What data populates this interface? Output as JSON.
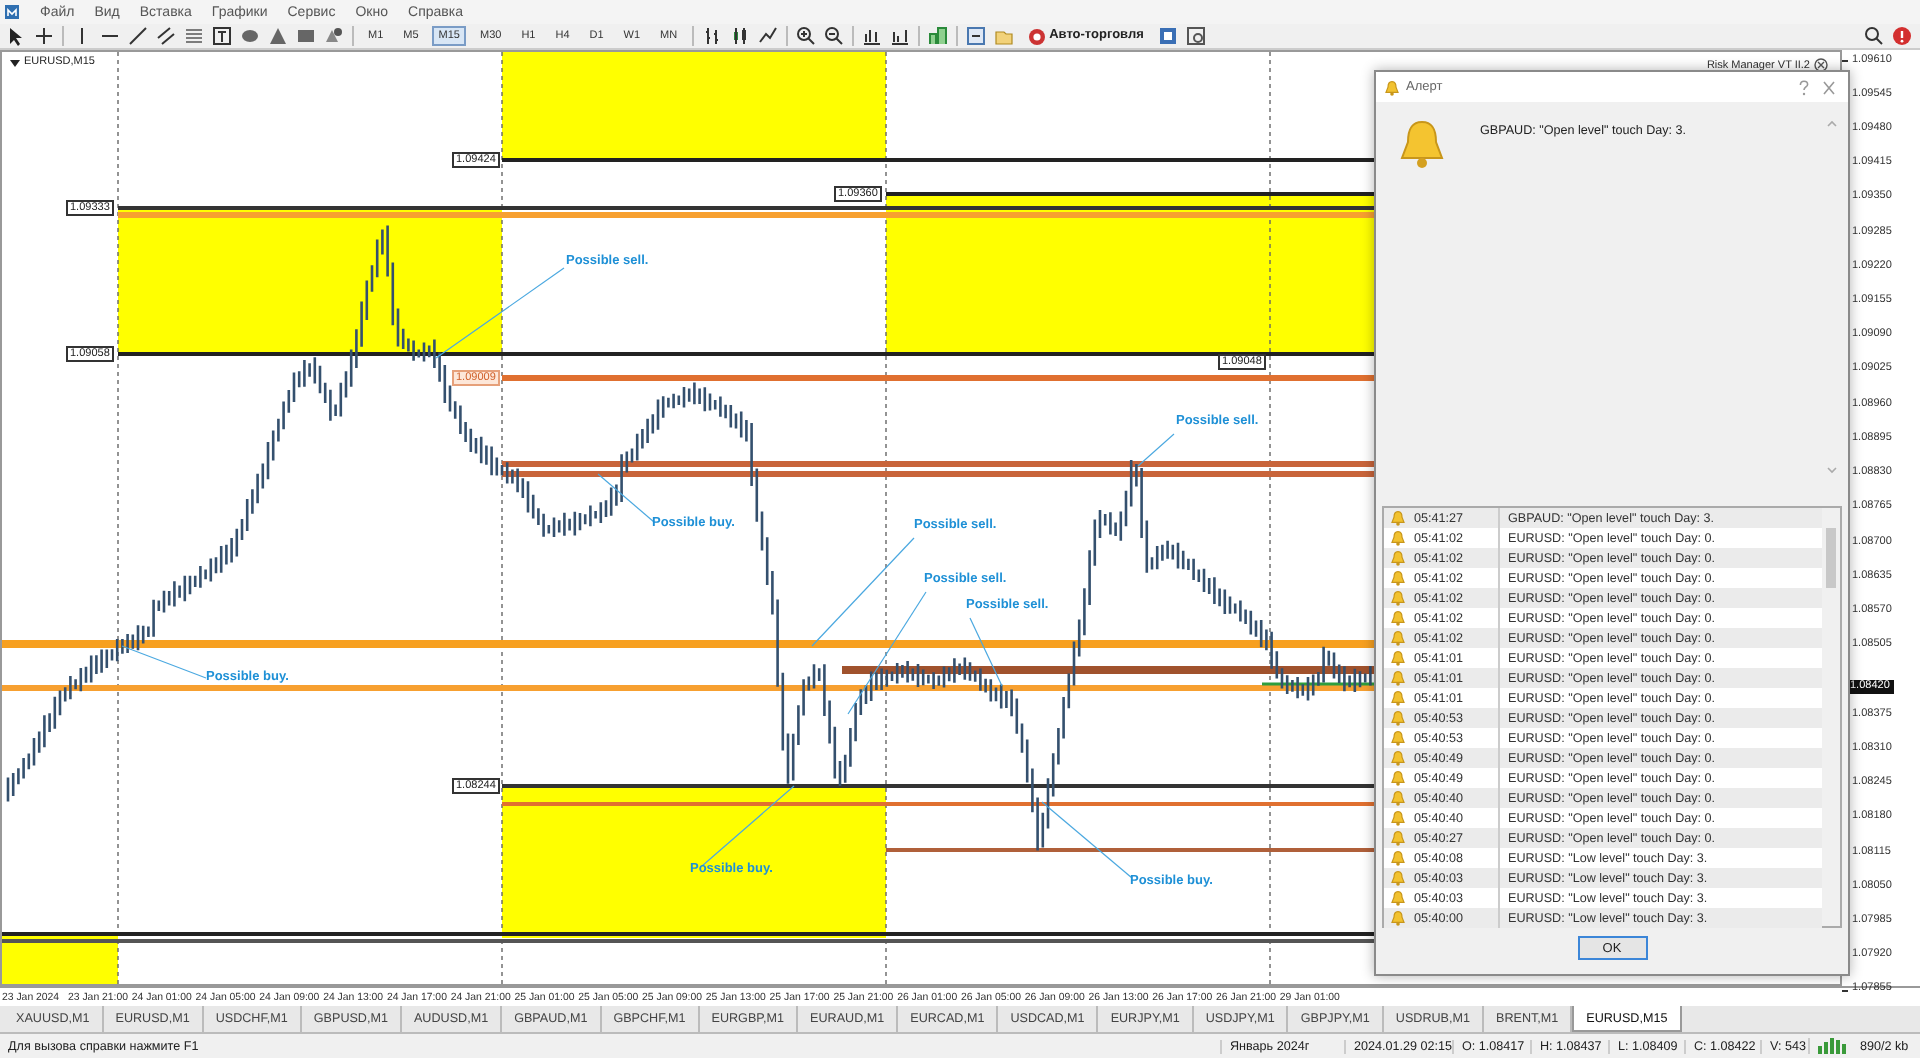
{
  "menu": [
    "Файл",
    "Вид",
    "Вставка",
    "Графики",
    "Сервис",
    "Окно",
    "Справка"
  ],
  "toolbar": {
    "timeframes": [
      {
        "label": "M1",
        "selected": false
      },
      {
        "label": "M5",
        "selected": false
      },
      {
        "label": "M15",
        "selected": true
      },
      {
        "label": "M30",
        "selected": false
      },
      {
        "label": "H1",
        "selected": false
      },
      {
        "label": "H4",
        "selected": false
      },
      {
        "label": "D1",
        "selected": false
      },
      {
        "label": "W1",
        "selected": false
      },
      {
        "label": "MN",
        "selected": false
      }
    ],
    "autotrading": "Авто-торговля"
  },
  "chart": {
    "title": "EURUSD,M15",
    "overlay_label": "Risk Manager VT II.2",
    "level_labels": [
      {
        "text": "1.09424",
        "kind": "black"
      },
      {
        "text": "1.09360",
        "kind": "black"
      },
      {
        "text": "1.09333",
        "kind": "black"
      },
      {
        "text": "1.09058",
        "kind": "black"
      },
      {
        "text": "1.09009",
        "kind": "orange"
      },
      {
        "text": "1.09048",
        "kind": "black"
      },
      {
        "text": "1.08244",
        "kind": "black"
      }
    ],
    "annotations": [
      "Possible sell.",
      "Possible sell.",
      "Possible sell.",
      "Possible sell.",
      "Possible sell.",
      "Possible buy.",
      "Possible buy.",
      "Possible buy.",
      "Possible buy."
    ],
    "price_axis": [
      "1.09610",
      "1.09545",
      "1.09480",
      "1.09415",
      "1.09350",
      "1.09285",
      "1.09220",
      "1.09155",
      "1.09090",
      "1.09025",
      "1.08960",
      "1.08895",
      "1.08830",
      "1.08765",
      "1.08700",
      "1.08635",
      "1.08570",
      "1.08505",
      "1.08375",
      "1.08310",
      "1.08245",
      "1.08180",
      "1.08115",
      "1.08050",
      "1.07985",
      "1.07920",
      "1.07855"
    ],
    "current_price": "1.08420",
    "time_axis": [
      "23 Jan 2024",
      "23 Jan 21:00",
      "24 Jan 01:00",
      "24 Jan 05:00",
      "24 Jan 09:00",
      "24 Jan 13:00",
      "24 Jan 17:00",
      "24 Jan 21:00",
      "25 Jan 01:00",
      "25 Jan 05:00",
      "25 Jan 09:00",
      "25 Jan 13:00",
      "25 Jan 17:00",
      "25 Jan 21:00",
      "26 Jan 01:00",
      "26 Jan 05:00",
      "26 Jan 09:00",
      "26 Jan 13:00",
      "26 Jan 17:00",
      "26 Jan 21:00",
      "29 Jan 01:00"
    ]
  },
  "alert": {
    "title": "Алерт",
    "message": "GBPAUD: \"Open level\" touch Day: 3.",
    "button": "OK",
    "rows": [
      {
        "time": "05:41:27",
        "text": "GBPAUD: \"Open level\" touch Day: 3."
      },
      {
        "time": "05:41:02",
        "text": "EURUSD: \"Open level\" touch Day: 0."
      },
      {
        "time": "05:41:02",
        "text": "EURUSD: \"Open level\" touch Day: 0."
      },
      {
        "time": "05:41:02",
        "text": "EURUSD: \"Open level\" touch Day: 0."
      },
      {
        "time": "05:41:02",
        "text": "EURUSD: \"Open level\" touch Day: 0."
      },
      {
        "time": "05:41:02",
        "text": "EURUSD: \"Open level\" touch Day: 0."
      },
      {
        "time": "05:41:02",
        "text": "EURUSD: \"Open level\" touch Day: 0."
      },
      {
        "time": "05:41:01",
        "text": "EURUSD: \"Open level\" touch Day: 0."
      },
      {
        "time": "05:41:01",
        "text": "EURUSD: \"Open level\" touch Day: 0."
      },
      {
        "time": "05:41:01",
        "text": "EURUSD: \"Open level\" touch Day: 0."
      },
      {
        "time": "05:40:53",
        "text": "EURUSD: \"Open level\" touch Day: 0."
      },
      {
        "time": "05:40:53",
        "text": "EURUSD: \"Open level\" touch Day: 0."
      },
      {
        "time": "05:40:49",
        "text": "EURUSD: \"Open level\" touch Day: 0."
      },
      {
        "time": "05:40:49",
        "text": "EURUSD: \"Open level\" touch Day: 0."
      },
      {
        "time": "05:40:40",
        "text": "EURUSD: \"Open level\" touch Day: 0."
      },
      {
        "time": "05:40:40",
        "text": "EURUSD: \"Open level\" touch Day: 0."
      },
      {
        "time": "05:40:27",
        "text": "EURUSD: \"Open level\" touch Day: 0."
      },
      {
        "time": "05:40:08",
        "text": "EURUSD: \"Low level\" touch Day: 3."
      },
      {
        "time": "05:40:03",
        "text": "EURUSD: \"Low level\" touch Day: 3."
      },
      {
        "time": "05:40:03",
        "text": "EURUSD: \"Low level\" touch Day: 3."
      },
      {
        "time": "05:40:00",
        "text": "EURUSD: \"Low level\" touch Day: 3."
      }
    ]
  },
  "tabs": [
    {
      "label": "XAUUSD,M1",
      "selected": false
    },
    {
      "label": "EURUSD,M1",
      "selected": false
    },
    {
      "label": "USDCHF,M1",
      "selected": false
    },
    {
      "label": "GBPUSD,M1",
      "selected": false
    },
    {
      "label": "AUDUSD,M1",
      "selected": false
    },
    {
      "label": "GBPAUD,M1",
      "selected": false
    },
    {
      "label": "GBPCHF,M1",
      "selected": false
    },
    {
      "label": "EURGBP,M1",
      "selected": false
    },
    {
      "label": "EURAUD,M1",
      "selected": false
    },
    {
      "label": "EURCAD,M1",
      "selected": false
    },
    {
      "label": "USDCAD,M1",
      "selected": false
    },
    {
      "label": "EURJPY,M1",
      "selected": false
    },
    {
      "label": "USDJPY,M1",
      "selected": false
    },
    {
      "label": "GBPJPY,M1",
      "selected": false
    },
    {
      "label": "USDRUB,M1",
      "selected": false
    },
    {
      "label": "BRENT,M1",
      "selected": false
    },
    {
      "label": "EURUSD,M15",
      "selected": true
    }
  ],
  "status_bar": {
    "help": "Для вызова справки нажмите F1",
    "period": "Январь 2024г",
    "datetime": "2024.01.29 02:15",
    "open": "O: 1.08417",
    "high": "H: 1.08437",
    "low": "L: 1.08409",
    "close": "C: 1.08422",
    "volume": "V: 543",
    "traffic": "890/2 kb"
  }
}
